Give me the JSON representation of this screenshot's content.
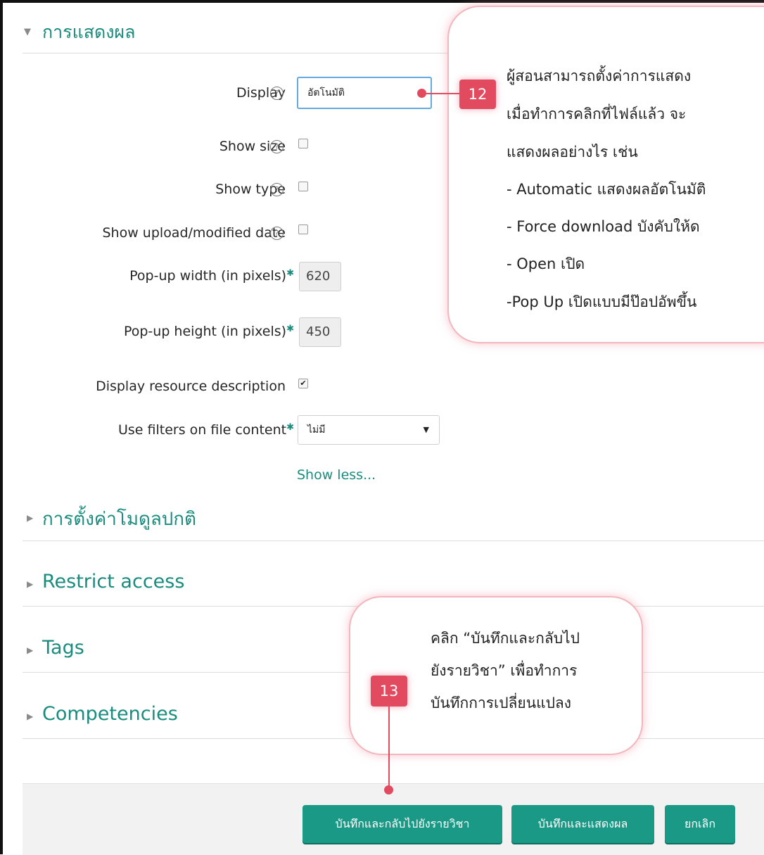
{
  "appearance": {
    "section_title": "การแสดงผล",
    "fields": {
      "display": {
        "label": "Display",
        "value": "อัตโนมัติ"
      },
      "show_size": {
        "label": "Show size",
        "checked": false
      },
      "show_type": {
        "label": "Show type",
        "checked": false
      },
      "show_date": {
        "label": "Show upload/modified date",
        "checked": false
      },
      "popup_width": {
        "label": "Pop-up width (in pixels)",
        "value": "620"
      },
      "popup_height": {
        "label": "Pop-up height (in pixels)",
        "value": "450"
      },
      "resource_description": {
        "label": "Display resource description",
        "checked": true
      },
      "filters": {
        "label": "Use filters on file content",
        "value": "ไม่มี"
      }
    },
    "show_less": "Show less..."
  },
  "sections": [
    {
      "title": "การตั้งค่าโมดูลปกติ"
    },
    {
      "title": "Restrict access"
    },
    {
      "title": "Tags"
    },
    {
      "title": "Competencies"
    }
  ],
  "buttons": {
    "save_return": "บันทึกและกลับไปยังรายวิชา",
    "save_display": "บันทึกและแสดงผล",
    "cancel": "ยกเลิก"
  },
  "annotations": {
    "callout_12": {
      "badge": "12",
      "lines": [
        "ผู้สอนสามารถตั้งค่าการแสดง",
        "เมื่อทำการคลิกที่ไฟล์แล้ว จะ",
        "แสดงผลอย่างไร เช่น",
        "- Automatic แสดงผลอัตโนมัติ",
        "- Force download บังคับให้ด",
        "- Open เปิด",
        "-Pop Up เปิดแบบมีป๊อปอัพขึ้น"
      ]
    },
    "callout_13": {
      "badge": "13",
      "lines": [
        "คลิก “บันทึกและกลับไป",
        "ยังรายวิชา” เพื่อทำการ",
        "บันทึกการเปลี่ยนแปลง"
      ]
    }
  },
  "colors": {
    "accent": "#1a8c7e",
    "button": "#1a9a86",
    "annotation": "#e14a5f",
    "callout_border": "#f3b6bd"
  },
  "icons": {
    "help": "question-circle-icon",
    "expanded": "triangle-down-icon",
    "collapsed": "triangle-right-icon",
    "select": "caret-down-icon"
  }
}
